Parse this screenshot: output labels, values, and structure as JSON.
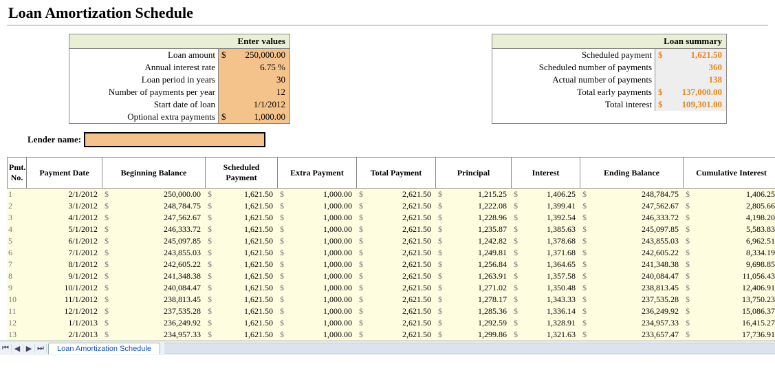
{
  "title": "Loan Amortization Schedule",
  "inputs_head": "Enter values",
  "summary_head": "Loan summary",
  "inputs": {
    "loan_amount_lbl": "Loan amount",
    "loan_amount": "250,000.00",
    "rate_lbl": "Annual interest rate",
    "rate": "6.75  %",
    "years_lbl": "Loan period in years",
    "years": "30",
    "per_year_lbl": "Number of payments per year",
    "per_year": "12",
    "start_lbl": "Start date of loan",
    "start": "1/1/2012",
    "extra_lbl": "Optional extra payments",
    "extra": "1,000.00"
  },
  "summary": {
    "sched_pay_lbl": "Scheduled payment",
    "sched_pay": "1,621.50",
    "sched_num_lbl": "Scheduled number of payments",
    "sched_num": "360",
    "actual_num_lbl": "Actual number of payments",
    "actual_num": "138",
    "early_lbl": "Total early payments",
    "early": "137,000.00",
    "interest_lbl": "Total interest",
    "interest": "109,301.00"
  },
  "lender_lbl": "Lender name:",
  "lender_value": "",
  "cols": [
    "Pmt. No.",
    "Payment Date",
    "Beginning Balance",
    "Scheduled Payment",
    "Extra Payment",
    "Total Payment",
    "Principal",
    "Interest",
    "Ending Balance",
    "Cumulative Interest"
  ],
  "rows": [
    {
      "n": "1",
      "date": "2/1/2012",
      "beg": "250,000.00",
      "sched": "1,621.50",
      "extra": "1,000.00",
      "tot": "2,621.50",
      "prin": "1,215.25",
      "int": "1,406.25",
      "end": "248,784.75",
      "cum": "1,406.25"
    },
    {
      "n": "2",
      "date": "3/1/2012",
      "beg": "248,784.75",
      "sched": "1,621.50",
      "extra": "1,000.00",
      "tot": "2,621.50",
      "prin": "1,222.08",
      "int": "1,399.41",
      "end": "247,562.67",
      "cum": "2,805.66"
    },
    {
      "n": "3",
      "date": "4/1/2012",
      "beg": "247,562.67",
      "sched": "1,621.50",
      "extra": "1,000.00",
      "tot": "2,621.50",
      "prin": "1,228.96",
      "int": "1,392.54",
      "end": "246,333.72",
      "cum": "4,198.20"
    },
    {
      "n": "4",
      "date": "5/1/2012",
      "beg": "246,333.72",
      "sched": "1,621.50",
      "extra": "1,000.00",
      "tot": "2,621.50",
      "prin": "1,235.87",
      "int": "1,385.63",
      "end": "245,097.85",
      "cum": "5,583.83"
    },
    {
      "n": "5",
      "date": "6/1/2012",
      "beg": "245,097.85",
      "sched": "1,621.50",
      "extra": "1,000.00",
      "tot": "2,621.50",
      "prin": "1,242.82",
      "int": "1,378.68",
      "end": "243,855.03",
      "cum": "6,962.51"
    },
    {
      "n": "6",
      "date": "7/1/2012",
      "beg": "243,855.03",
      "sched": "1,621.50",
      "extra": "1,000.00",
      "tot": "2,621.50",
      "prin": "1,249.81",
      "int": "1,371.68",
      "end": "242,605.22",
      "cum": "8,334.19"
    },
    {
      "n": "7",
      "date": "8/1/2012",
      "beg": "242,605.22",
      "sched": "1,621.50",
      "extra": "1,000.00",
      "tot": "2,621.50",
      "prin": "1,256.84",
      "int": "1,364.65",
      "end": "241,348.38",
      "cum": "9,698.85"
    },
    {
      "n": "8",
      "date": "9/1/2012",
      "beg": "241,348.38",
      "sched": "1,621.50",
      "extra": "1,000.00",
      "tot": "2,621.50",
      "prin": "1,263.91",
      "int": "1,357.58",
      "end": "240,084.47",
      "cum": "11,056.43"
    },
    {
      "n": "9",
      "date": "10/1/2012",
      "beg": "240,084.47",
      "sched": "1,621.50",
      "extra": "1,000.00",
      "tot": "2,621.50",
      "prin": "1,271.02",
      "int": "1,350.48",
      "end": "238,813.45",
      "cum": "12,406.91"
    },
    {
      "n": "10",
      "date": "11/1/2012",
      "beg": "238,813.45",
      "sched": "1,621.50",
      "extra": "1,000.00",
      "tot": "2,621.50",
      "prin": "1,278.17",
      "int": "1,343.33",
      "end": "237,535.28",
      "cum": "13,750.23"
    },
    {
      "n": "11",
      "date": "12/1/2012",
      "beg": "237,535.28",
      "sched": "1,621.50",
      "extra": "1,000.00",
      "tot": "2,621.50",
      "prin": "1,285.36",
      "int": "1,336.14",
      "end": "236,249.92",
      "cum": "15,086.37"
    },
    {
      "n": "12",
      "date": "1/1/2013",
      "beg": "236,249.92",
      "sched": "1,621.50",
      "extra": "1,000.00",
      "tot": "2,621.50",
      "prin": "1,292.59",
      "int": "1,328.91",
      "end": "234,957.33",
      "cum": "16,415.27"
    },
    {
      "n": "13",
      "date": "2/1/2013",
      "beg": "234,957.33",
      "sched": "1,621.50",
      "extra": "1,000.00",
      "tot": "2,621.50",
      "prin": "1,299.86",
      "int": "1,321.63",
      "end": "233,657.47",
      "cum": "17,736.91"
    }
  ],
  "tab_label": "Loan Amortization Schedule"
}
